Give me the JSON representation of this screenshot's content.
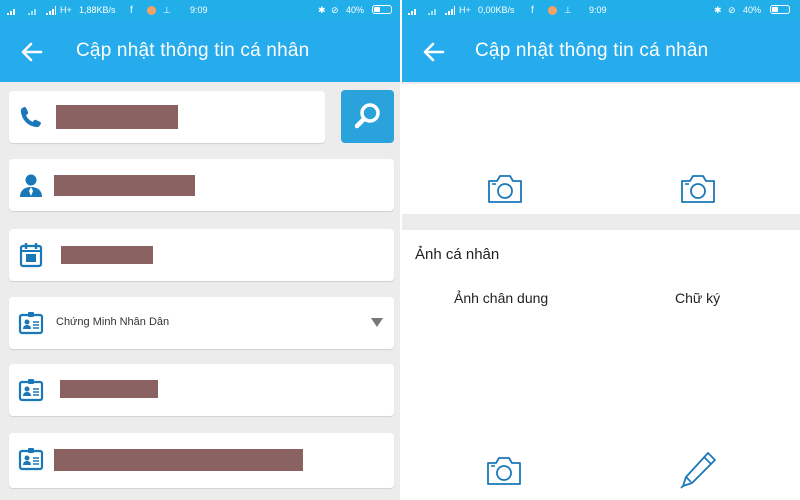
{
  "status_left": {
    "network": "H+",
    "speed": "1,88KB/s",
    "time": "9:09",
    "battery": "40%"
  },
  "status_right": {
    "network": "H+",
    "speed": "0,00KB/s",
    "time": "9:09",
    "battery": "40%"
  },
  "header": {
    "title": "Cập nhật thông tin cá nhân"
  },
  "form": {
    "id_type": "Chứng Minh Nhân Dân",
    "icons": [
      "phone-icon",
      "person-icon",
      "calendar-icon",
      "id-card-icon",
      "id-card-icon",
      "id-card-icon"
    ]
  },
  "photos": {
    "section_title": "Ảnh cá nhân",
    "portrait_label": "Ảnh chân dung",
    "signature_label": "Chữ ký",
    "icons": [
      "camera-icon",
      "pen-icon"
    ]
  },
  "colors": {
    "accent": "#26acec",
    "search_button": "#2aa3dd",
    "icon": "#1a78b8",
    "redaction": "#8a6262"
  }
}
